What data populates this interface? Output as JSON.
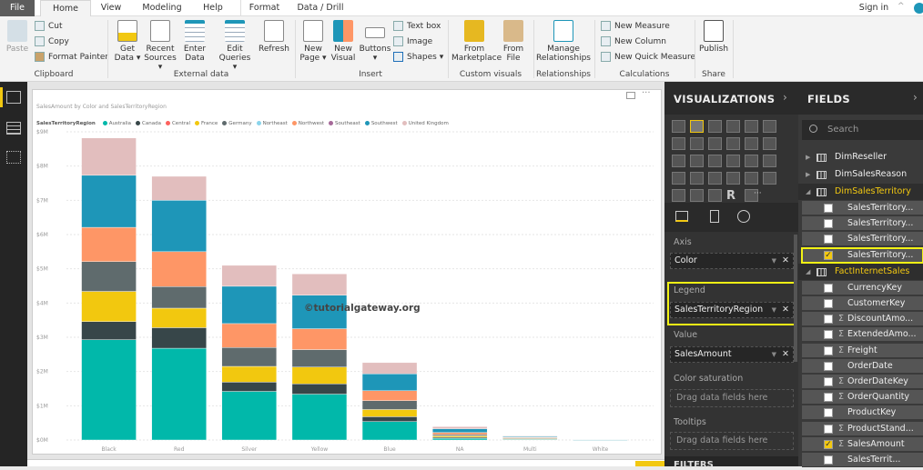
{
  "tabs": [
    "File",
    "Home",
    "View",
    "Modeling",
    "Help",
    "Format",
    "Data / Drill"
  ],
  "sign_in": "Sign in",
  "ribbon": {
    "clipboard": {
      "paste": "Paste",
      "cut": "Cut",
      "copy": "Copy",
      "format_painter": "Format Painter",
      "label": "Clipboard"
    },
    "external": {
      "get_data": "Get Data ▾",
      "recent_sources": "Recent Sources ▾",
      "enter_data": "Enter Data",
      "edit_queries": "Edit Queries ▾",
      "refresh": "Refresh",
      "label": "External data"
    },
    "insert": {
      "new_page": "New Page ▾",
      "new_visual": "New Visual",
      "buttons": "Buttons ▾",
      "text_box": "Text box",
      "image": "Image",
      "shapes": "Shapes ▾",
      "label": "Insert"
    },
    "custom": {
      "from_marketplace": "From Marketplace",
      "from_file": "From File",
      "label": "Custom visuals"
    },
    "relationships": {
      "manage": "Manage Relationships",
      "label": "Relationships"
    },
    "calculations": {
      "new_measure": "New Measure",
      "new_column": "New Column",
      "new_quick_measure": "New Quick Measure",
      "label": "Calculations"
    },
    "share": {
      "publish": "Publish",
      "label": "Share"
    }
  },
  "visualizations": {
    "title": "VISUALIZATIONS",
    "axis_label": "Axis",
    "axis_value": "Color",
    "legend_label": "Legend",
    "legend_value": "SalesTerritoryRegion",
    "value_label": "Value",
    "value_value": "SalesAmount",
    "color_saturation_label": "Color saturation",
    "tooltips_label": "Tooltips",
    "drop_placeholder": "Drag data fields here",
    "filters": "FILTERS"
  },
  "fields": {
    "title": "FIELDS",
    "search_placeholder": "Search",
    "tables": [
      {
        "name": "DimReseller",
        "expanded": false
      },
      {
        "name": "DimSalesReason",
        "expanded": false
      },
      {
        "name": "DimSalesTerritory",
        "expanded": true,
        "fields": [
          {
            "name": "SalesTerritory...",
            "checked": false,
            "sigma": false
          },
          {
            "name": "SalesTerritory...",
            "checked": false,
            "sigma": false
          },
          {
            "name": "SalesTerritory...",
            "checked": false,
            "sigma": false
          },
          {
            "name": "SalesTerritory...",
            "checked": true,
            "sigma": false
          }
        ]
      },
      {
        "name": "FactInternetSales",
        "expanded": true,
        "fields": [
          {
            "name": "CurrencyKey",
            "checked": false,
            "sigma": false
          },
          {
            "name": "CustomerKey",
            "checked": false,
            "sigma": false
          },
          {
            "name": "DiscountAmo...",
            "checked": false,
            "sigma": true
          },
          {
            "name": "ExtendedAmo...",
            "checked": false,
            "sigma": true
          },
          {
            "name": "Freight",
            "checked": false,
            "sigma": true
          },
          {
            "name": "OrderDate",
            "checked": false,
            "sigma": false
          },
          {
            "name": "OrderDateKey",
            "checked": false,
            "sigma": true
          },
          {
            "name": "OrderQuantity",
            "checked": false,
            "sigma": true
          },
          {
            "name": "ProductKey",
            "checked": false,
            "sigma": false
          },
          {
            "name": "ProductStand...",
            "checked": false,
            "sigma": true
          },
          {
            "name": "SalesAmount",
            "checked": true,
            "sigma": true
          },
          {
            "name": "SalesTerrit...",
            "checked": false,
            "sigma": false
          }
        ]
      }
    ]
  },
  "watermark": "©tutorialgateway.org",
  "colors": {
    "accent": "#f2c811"
  },
  "chart_data": {
    "type": "bar",
    "stacked": true,
    "title": "SalesAmount by Color and SalesTerritoryRegion",
    "legend_title": "SalesTerritoryRegion",
    "legend_position": "top-left",
    "xlabel": "",
    "ylabel": "",
    "ylim": [
      0,
      9
    ],
    "yticks": [
      "$0M",
      "$1M",
      "$2M",
      "$3M",
      "$4M",
      "$5M",
      "$6M",
      "$7M",
      "$8M",
      "$9M"
    ],
    "categories": [
      "Black",
      "Red",
      "Silver",
      "Yellow",
      "Blue",
      "NA",
      "Multi",
      "White"
    ],
    "series": [
      {
        "name": "Australia",
        "color": "#01b8aa",
        "values": [
          2.93,
          2.68,
          1.42,
          1.34,
          0.54,
          0.05,
          0.02,
          0.001
        ]
      },
      {
        "name": "Canada",
        "color": "#374649",
        "values": [
          0.53,
          0.6,
          0.27,
          0.3,
          0.14,
          0.03,
          0.01,
          0
        ]
      },
      {
        "name": "Central",
        "color": "#fd625e",
        "values": [
          0,
          0,
          0,
          0,
          0,
          0,
          0,
          0
        ]
      },
      {
        "name": "France",
        "color": "#f2c80f",
        "values": [
          0.88,
          0.57,
          0.46,
          0.49,
          0.21,
          0.04,
          0.01,
          0
        ]
      },
      {
        "name": "Germany",
        "color": "#5f6b6d",
        "values": [
          0.87,
          0.63,
          0.55,
          0.51,
          0.26,
          0.04,
          0.02,
          0
        ]
      },
      {
        "name": "Northeast",
        "color": "#8ad4eb",
        "values": [
          0,
          0,
          0,
          0,
          0,
          0,
          0,
          0
        ]
      },
      {
        "name": "Northwest",
        "color": "#fe9666",
        "values": [
          1.0,
          1.02,
          0.7,
          0.61,
          0.29,
          0.06,
          0.02,
          0.001
        ]
      },
      {
        "name": "Southeast",
        "color": "#a66999",
        "values": [
          0,
          0,
          0,
          0,
          0,
          0,
          0,
          0
        ]
      },
      {
        "name": "Southwest",
        "color": "#1e96b8",
        "values": [
          1.52,
          1.5,
          1.09,
          0.98,
          0.49,
          0.11,
          0.03,
          0.002
        ]
      },
      {
        "name": "United Kingdom",
        "color": "#e2bebe",
        "values": [
          1.09,
          0.7,
          0.61,
          0.62,
          0.33,
          0.06,
          0.01,
          0
        ]
      }
    ]
  }
}
